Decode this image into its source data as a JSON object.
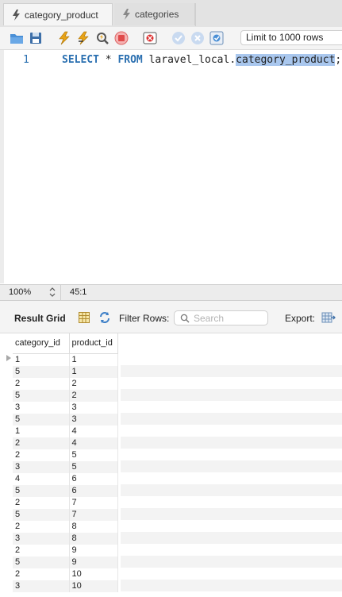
{
  "tabs": [
    {
      "label": "category_product",
      "active": true
    },
    {
      "label": "categories",
      "active": false
    }
  ],
  "toolbar": {
    "icons": [
      "open-folder-icon",
      "save-icon",
      "execute-icon",
      "execute-current-icon",
      "explain-icon",
      "stop-icon",
      "toggle-error-icon",
      "commit-icon",
      "rollback-icon",
      "autocommit-icon"
    ],
    "limit_value": "Limit to 1000 rows"
  },
  "editor": {
    "line_number": "1",
    "kw_select": "SELECT",
    "star": " * ",
    "kw_from": "FROM",
    "schema": " laravel_local.",
    "table": "category_product",
    "semicolon": ";"
  },
  "status": {
    "zoom": "100%",
    "cursor": "45:1"
  },
  "result_toolbar": {
    "title": "Result Grid",
    "filter_label": "Filter Rows:",
    "search_placeholder": "Search",
    "export_label": "Export:"
  },
  "grid": {
    "columns": [
      "category_id",
      "product_id"
    ],
    "rows": [
      [
        "1",
        "1"
      ],
      [
        "5",
        "1"
      ],
      [
        "2",
        "2"
      ],
      [
        "5",
        "2"
      ],
      [
        "3",
        "3"
      ],
      [
        "5",
        "3"
      ],
      [
        "1",
        "4"
      ],
      [
        "2",
        "4"
      ],
      [
        "2",
        "5"
      ],
      [
        "3",
        "5"
      ],
      [
        "4",
        "6"
      ],
      [
        "5",
        "6"
      ],
      [
        "2",
        "7"
      ],
      [
        "5",
        "7"
      ],
      [
        "2",
        "8"
      ],
      [
        "3",
        "8"
      ],
      [
        "2",
        "9"
      ],
      [
        "5",
        "9"
      ],
      [
        "2",
        "10"
      ],
      [
        "3",
        "10"
      ]
    ]
  },
  "colors": {
    "keyword": "#2a6fb0",
    "selection": "#a9c7ee",
    "row_stripe": "#f3f3f3"
  }
}
